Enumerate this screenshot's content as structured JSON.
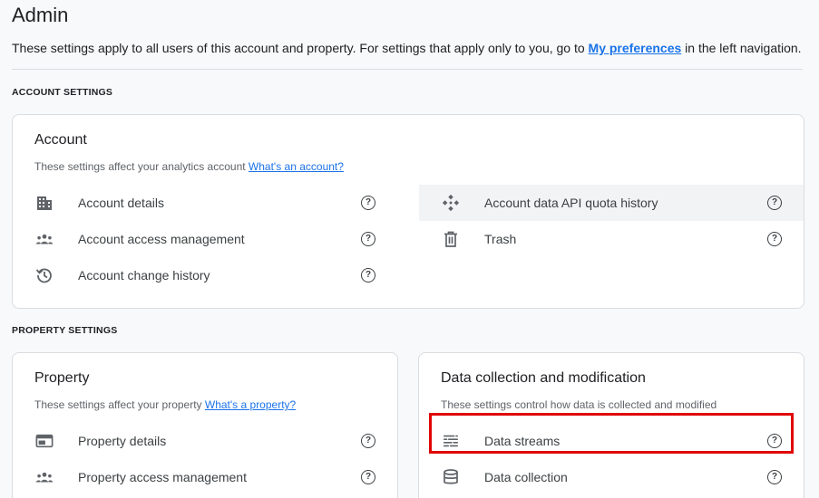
{
  "page": {
    "title": "Admin",
    "intro_prefix": "These settings apply to all users of this account and property. For settings that apply only to you, go to ",
    "intro_link": "My preferences",
    "intro_suffix": " in the left navigation."
  },
  "account_section": {
    "heading": "ACCOUNT SETTINGS",
    "card": {
      "title": "Account",
      "desc": "These settings affect your analytics account ",
      "desc_link": "What's an account?",
      "left_items": [
        {
          "label": "Account details",
          "icon": "building-icon"
        },
        {
          "label": "Account access management",
          "icon": "people-icon"
        },
        {
          "label": "Account change history",
          "icon": "history-icon"
        }
      ],
      "right_items": [
        {
          "label": "Account data API quota history",
          "icon": "api-quota-icon"
        },
        {
          "label": "Trash",
          "icon": "trash-icon"
        }
      ]
    }
  },
  "property_section": {
    "heading": "PROPERTY SETTINGS",
    "property_card": {
      "title": "Property",
      "desc": "These settings affect your property ",
      "desc_link": "What's a property?",
      "items": [
        {
          "label": "Property details",
          "icon": "web-asset-icon"
        },
        {
          "label": "Property access management",
          "icon": "people-icon"
        }
      ]
    },
    "data_card": {
      "title": "Data collection and modification",
      "desc": "These settings control how data is collected and modified",
      "items": [
        {
          "label": "Data streams",
          "icon": "data-streams-icon"
        },
        {
          "label": "Data collection",
          "icon": "database-icon"
        }
      ]
    }
  },
  "help_glyph": "?",
  "colors": {
    "link": "#1a73e8",
    "highlight_box": "#e00000",
    "hover_row": "#f1f3f4"
  }
}
